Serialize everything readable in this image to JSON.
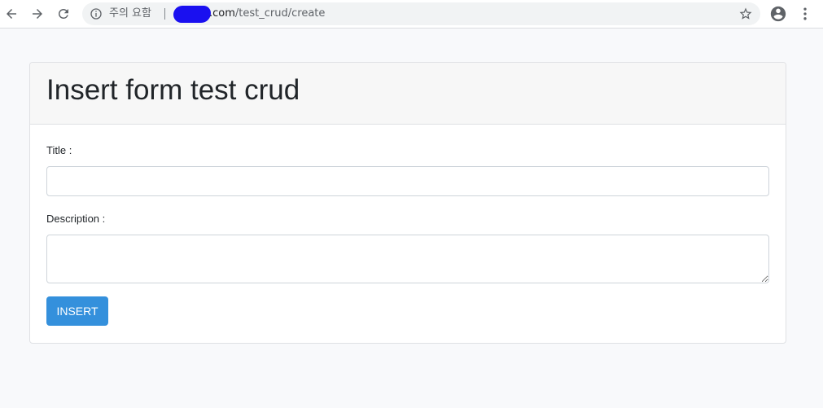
{
  "browser": {
    "security_label": "주의 요함",
    "url_host": ".com",
    "url_path": "/test_crud/create",
    "icons": {
      "back": "back-arrow-icon",
      "forward": "forward-arrow-icon",
      "reload": "reload-icon",
      "info": "info-icon",
      "bookmark": "star-icon",
      "account": "account-icon",
      "menu": "kebab-menu-icon"
    }
  },
  "form": {
    "header": "Insert form test crud",
    "title_label": "Title :",
    "title_value": "",
    "description_label": "Description :",
    "description_value": "",
    "submit_label": "INSERT"
  },
  "colors": {
    "accent": "#3490dc",
    "page_background": "#f8f9fb",
    "card_header_background": "#f7f7f7",
    "url_redaction": "#1a10f0"
  }
}
